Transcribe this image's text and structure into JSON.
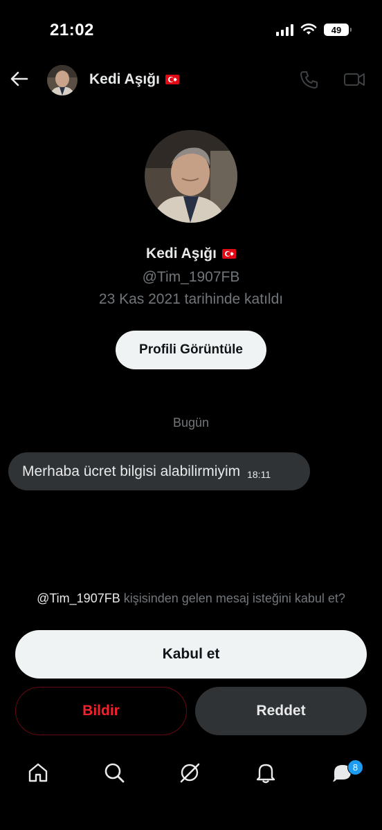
{
  "status": {
    "time": "21:02",
    "battery": "49"
  },
  "header": {
    "name": "Kedi Aşığı",
    "back_icon": "arrow-left-icon",
    "call_icon": "phone-icon",
    "video_icon": "video-icon"
  },
  "profile": {
    "name": "Kedi Aşığı",
    "handle": "@Tim_1907FB",
    "joined": "23 Kas 2021 tarihinde katıldı",
    "view_button": "Profili Görüntüle"
  },
  "conversation": {
    "day_label": "Bugün",
    "messages": [
      {
        "text": "Merhaba ücret bilgisi alabilirmiyim",
        "time": "18:11"
      }
    ]
  },
  "request": {
    "handle": "@Tim_1907FB",
    "text": "kişisinden gelen mesaj isteğini kabul et?",
    "accept": "Kabul et",
    "report": "Bildir",
    "decline": "Reddet"
  },
  "nav": {
    "items": [
      "home-icon",
      "search-icon",
      "grok-icon",
      "bell-icon",
      "messages-icon"
    ],
    "messages_badge": "8"
  },
  "colors": {
    "background": "#000000",
    "bubble": "#2f3336",
    "muted": "#71767b",
    "danger": "#f4212e",
    "accent": "#1d9bf0"
  }
}
